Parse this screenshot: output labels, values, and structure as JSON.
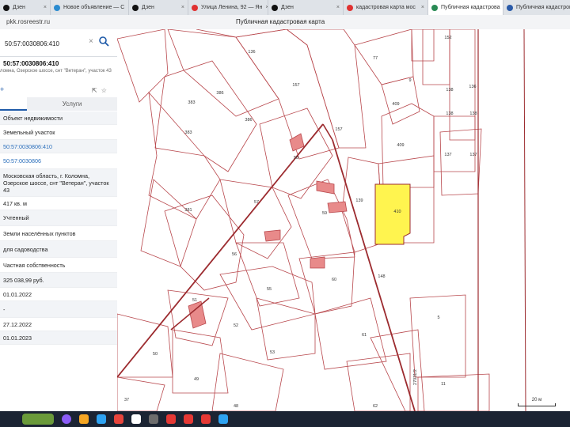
{
  "browser": {
    "tabs": [
      {
        "title": "Дзен",
        "fav": "#111111",
        "w": 55,
        "active": false
      },
      {
        "title": "Новое объявление — С",
        "fav": "#2a8bd0",
        "w": 90,
        "active": false
      },
      {
        "title": "Дзен",
        "fav": "#111111",
        "w": 66,
        "active": false
      },
      {
        "title": "Улица Ленина, 92 — Ян",
        "fav": "#e03131",
        "w": 92,
        "active": false
      },
      {
        "title": "Дзен",
        "fav": "#111111",
        "w": 86,
        "active": false
      },
      {
        "title": "кадастровая карта мос",
        "fav": "#e03131",
        "w": 98,
        "active": false
      },
      {
        "title": "Публичная кадастрова",
        "fav": "#2a8b55",
        "w": 86,
        "active": true
      },
      {
        "title": "Публичная кадастрова",
        "fav": "#2a5aa8",
        "w": 100,
        "active": false
      }
    ],
    "url": "pkk.rosreestr.ru",
    "page_title": "Публичная кадастровая карта"
  },
  "panel": {
    "search_value": "50:57:0030806:410",
    "cad_title": "50:57:0030806:410",
    "address_short": "ломна, Озерское шоссе, снт \"Ветеран\", участок 43",
    "tab_info": "",
    "tab_services": "Услуги",
    "rows": [
      {
        "text": "Объект недвижимости",
        "h": 17,
        "alt": true,
        "link": false
      },
      {
        "text": "Земельный участок",
        "h": 19,
        "alt": false,
        "link": false
      },
      {
        "text": "50:57:0030806:410",
        "h": 17,
        "alt": true,
        "link": true
      },
      {
        "text": "50:57:0030806",
        "h": 20,
        "alt": false,
        "link": true
      },
      {
        "text": "Московская область, г. Коломна, Озерское шоссе, снт \"Ветеран\", участок 43",
        "h": 35,
        "alt": true,
        "link": false
      },
      {
        "text": "417 кв. м",
        "h": 17,
        "alt": false,
        "link": false
      },
      {
        "text": "Учтенный",
        "h": 20,
        "alt": true,
        "link": false
      },
      {
        "text": "Земли населённых пунктов",
        "h": 19,
        "alt": false,
        "link": false
      },
      {
        "text": "для садоводства",
        "h": 21,
        "alt": true,
        "link": false
      },
      {
        "text": "Частная собственность",
        "h": 19,
        "alt": false,
        "link": false
      },
      {
        "text": "325 038,99 руб.",
        "h": 19,
        "alt": true,
        "link": false
      },
      {
        "text": "01.01.2022",
        "h": 17,
        "alt": false,
        "link": false
      },
      {
        "text": "-",
        "h": 21,
        "alt": true,
        "link": false
      },
      {
        "text": "27.12.2022",
        "h": 17,
        "alt": false,
        "link": false
      },
      {
        "text": "01.01.2023",
        "h": 17,
        "alt": true,
        "link": false
      }
    ]
  },
  "map": {
    "parcel_labels": [
      "136",
      "157",
      "157",
      "152",
      "77",
      "9",
      "138",
      "138",
      "138",
      "136",
      "409",
      "409",
      "137",
      "137",
      "386",
      "386",
      "383",
      "383",
      "58",
      "57",
      "59",
      "139",
      "410",
      "381",
      "56",
      "60",
      "148",
      "55",
      "51",
      "52",
      "53",
      "61",
      "50",
      "49",
      "48",
      "5",
      "11",
      "62",
      "37",
      "27031/2"
    ],
    "building_labels": [
      "",
      "",
      "",
      "",
      "",
      ""
    ],
    "selected_fill": "#fff44f",
    "scale_label": "20 м"
  },
  "taskbar": {
    "icons": [
      {
        "name": "cortana-icon",
        "color": "#8b5cf6"
      },
      {
        "name": "files-icon",
        "color": "#f5a623"
      },
      {
        "name": "edge-icon",
        "color": "#2ea3f2"
      },
      {
        "name": "chrome-icon",
        "color": "#e8453c"
      },
      {
        "name": "yandex-icon",
        "color": "#ffffff"
      },
      {
        "name": "app-icon",
        "color": "#6d6d6d"
      },
      {
        "name": "mail-icon",
        "color": "#e53935"
      },
      {
        "name": "pdf-icon",
        "color": "#e53935"
      },
      {
        "name": "camera-icon",
        "color": "#e53935"
      },
      {
        "name": "settings-icon",
        "color": "#2ea3f2"
      }
    ]
  }
}
